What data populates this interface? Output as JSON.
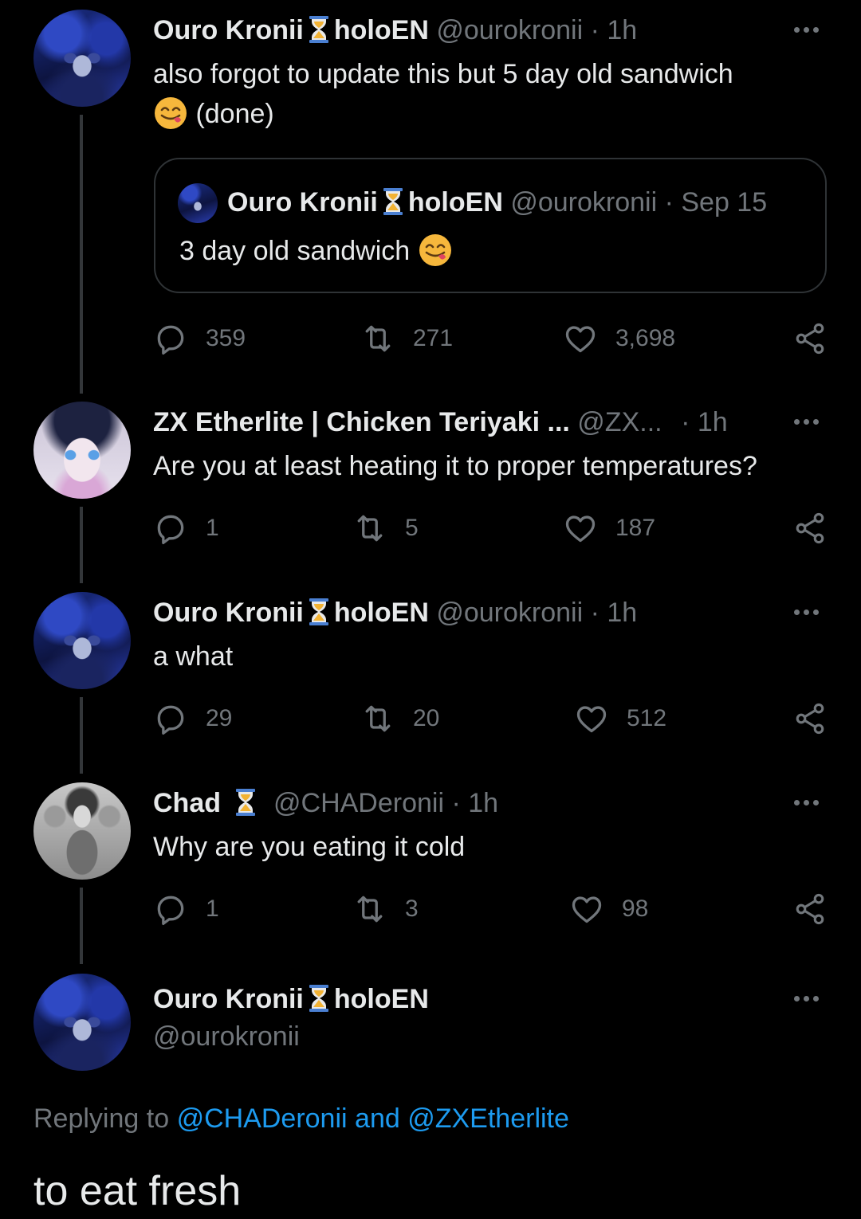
{
  "tweets": [
    {
      "name": "Ouro Kronii",
      "org": "holoEN",
      "handle": "@ourokronii",
      "time": "· 1h",
      "text_line1": "also forgot to update this but 5 day old sandwich",
      "text_line2": "(done)",
      "emoji": "savoring-face-emoji",
      "quote": {
        "name": "Ouro Kronii",
        "org": "holoEN",
        "handle": "@ourokronii",
        "time": "· Sep 15",
        "text": "3 day old sandwich",
        "emoji": "savoring-face-emoji"
      },
      "replies": "359",
      "retweets": "271",
      "likes": "3,698"
    },
    {
      "name": "ZX Etherlite | Chicken Teriyaki ...",
      "handle": "@ZX...",
      "time": "· 1h",
      "text": "Are you at least heating it to proper temperatures?",
      "replies": "1",
      "retweets": "5",
      "likes": "187"
    },
    {
      "name": "Ouro Kronii",
      "org": "holoEN",
      "handle": "@ourokronii",
      "time": "· 1h",
      "text": "a what",
      "replies": "29",
      "retweets": "20",
      "likes": "512"
    },
    {
      "name": "Chad",
      "handle": "@CHADeronii",
      "time": "· 1h",
      "text": "Why are you eating it cold",
      "replies": "1",
      "retweets": "3",
      "likes": "98"
    }
  ],
  "main_tweet": {
    "name": "Ouro Kronii",
    "org": "holoEN",
    "handle": "@ourokronii",
    "replying_prefix": "Replying to",
    "replying_user1": "@CHADeronii",
    "replying_and": "and",
    "replying_user2": "@ZXEtherlite",
    "text": "to eat fresh"
  },
  "colors": {
    "background": "#000000",
    "text": "#e7e9ea",
    "muted": "#71767b",
    "link": "#1d9bf0",
    "hourglass": "#f2b233"
  }
}
